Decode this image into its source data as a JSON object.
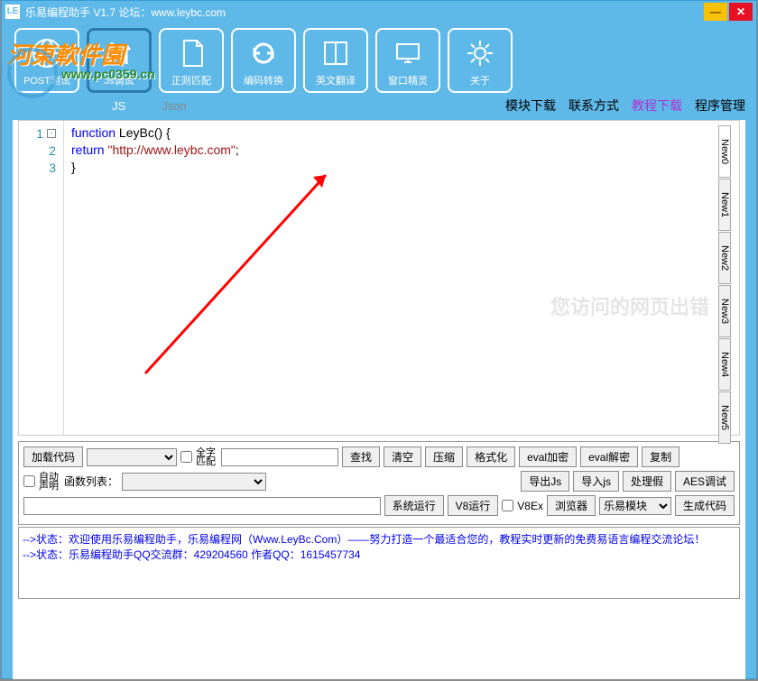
{
  "title": "乐易编程助手 V1.7 论坛：www.leybc.com",
  "watermark": {
    "text": "河東軟件園",
    "url": "www.pc0359.cn"
  },
  "toolbar": [
    {
      "key": "post",
      "label": "POST测试"
    },
    {
      "key": "js",
      "label": "Js调试"
    },
    {
      "key": "regex",
      "label": "正则匹配"
    },
    {
      "key": "encode",
      "label": "编码转换"
    },
    {
      "key": "translate",
      "label": "英文翻译"
    },
    {
      "key": "window",
      "label": "窗口精灵"
    },
    {
      "key": "about",
      "label": "关于"
    }
  ],
  "subtabs": {
    "left": [
      "JS",
      "Json"
    ],
    "right": [
      {
        "label": "模块下载",
        "color": "#000"
      },
      {
        "label": "联系方式",
        "color": "#000"
      },
      {
        "label": "教程下载",
        "color": "#b030d0"
      },
      {
        "label": "程序管理",
        "color": "#000"
      }
    ]
  },
  "code": {
    "lines": [
      {
        "n": 1,
        "tokens": [
          [
            "kw",
            "function"
          ],
          [
            "plain",
            " LeyBc() {"
          ]
        ]
      },
      {
        "n": 2,
        "tokens": [
          [
            "kw",
            "    return "
          ],
          [
            "str",
            "\"http://www.leybc.com\""
          ],
          [
            "plain",
            ";"
          ]
        ]
      },
      {
        "n": 3,
        "tokens": [
          [
            "plain",
            "}"
          ]
        ]
      }
    ]
  },
  "sidetabs": [
    "New0",
    "New1",
    "New2",
    "New3",
    "New4",
    "New5"
  ],
  "ghost": "您访问的网页出错",
  "ctrl": {
    "loadCode": "加载代码",
    "fullMatch": "全字匹配",
    "find": "查找",
    "clear": "清空",
    "compress": "压缩",
    "format": "格式化",
    "evalEnc": "eval加密",
    "evalDec": "eval解密",
    "copy": "复制",
    "autoDecl": "自动声明",
    "funcList": "函数列表：",
    "exportJs": "导出Js",
    "importJs": "导入js",
    "handleFake": "处理假",
    "aesDebug": "AES调试",
    "sysRun": "系统运行",
    "v8Run": "V8运行",
    "v8ex": "V8Ex",
    "browser": "浏览器",
    "leyModule": "乐易模块",
    "genCode": "生成代码"
  },
  "log": [
    "-->状态：欢迎使用乐易编程助手，乐易编程网（Www.LeyBc.Com）——努力打造一个最适合您的，教程实时更新的免费易语言编程交流论坛！",
    "-->状态：乐易编程助手QQ交流群：429204560 作者QQ：1615457734"
  ]
}
